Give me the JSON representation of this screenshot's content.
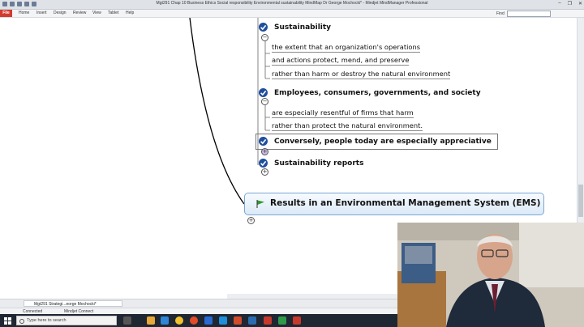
{
  "window": {
    "title": "Mgt291 Chap 10 Business Ethics Social responsibility Environmental sustainability MindMap Dr George Mochocki* - Mindjet MindManager Professional",
    "controls": [
      "–",
      "❐",
      "✕"
    ]
  },
  "ribbon": {
    "tabs": [
      "File",
      "Home",
      "Insert",
      "Design",
      "Review",
      "View",
      "Tablet",
      "Help"
    ],
    "find_label": "Find"
  },
  "mindmap": {
    "topics": [
      {
        "label": "Sustainability",
        "subtopics": [
          "the extent that an organization's operations",
          "and actions protect, mend, and preserve",
          "rather than harm or destroy the natural environment"
        ]
      },
      {
        "label": "Employees, consumers, governments, and society",
        "subtopics": [
          "are especially resentful of firms that harm",
          "rather than protect the natural environment."
        ]
      },
      {
        "label": "Conversely, people today are especially appreciative",
        "subtopics": []
      },
      {
        "label": "Sustainability reports",
        "subtopics": []
      }
    ],
    "main_topic": {
      "label": "Results in an Environmental Management System (EMS)",
      "icon": "green-flag-icon"
    }
  },
  "document_tab": {
    "label": "Mgt291 Strategi...eorge Mochocki*"
  },
  "status": {
    "connection": "Connected",
    "product": "Mindjet Connect"
  },
  "taskbar": {
    "search_placeholder": "Type here to search"
  },
  "colors": {
    "accent": "#1f4e9c",
    "file_tab": "#d23b2f",
    "ems_border": "#7aa7d3",
    "flag": "#2e9a2e"
  }
}
